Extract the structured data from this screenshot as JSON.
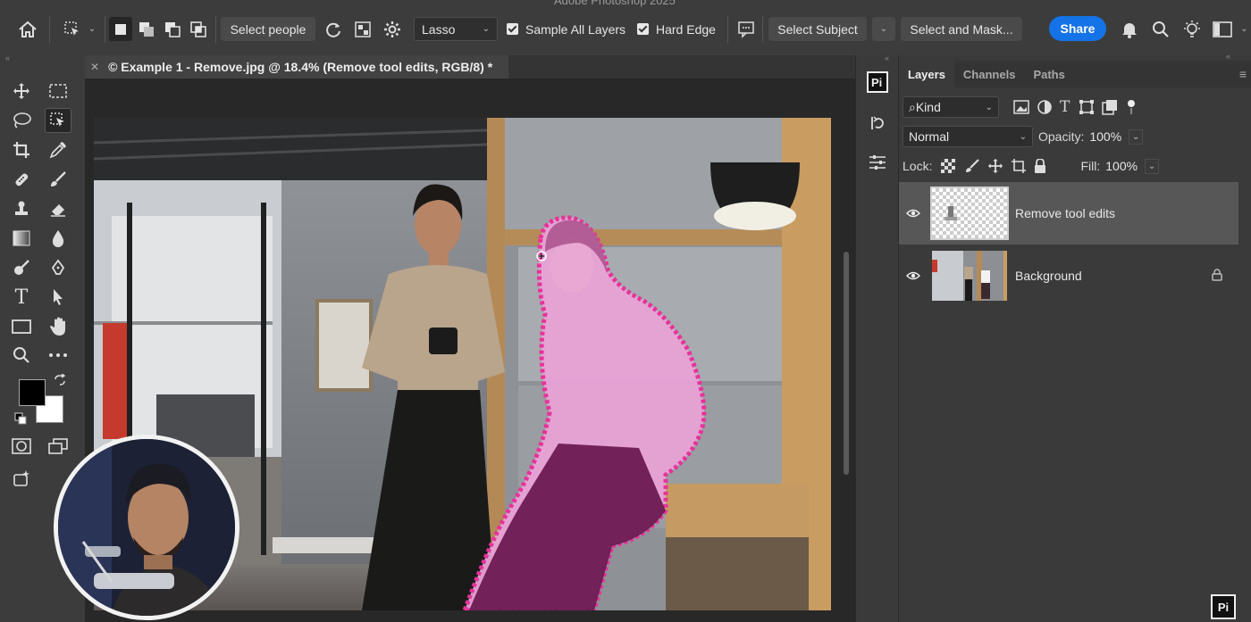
{
  "app": {
    "window_title": "Adobe Photoshop 2025"
  },
  "options_bar": {
    "select_people_label": "Select people",
    "lasso_value": "Lasso",
    "sample_all_layers_label": "Sample All Layers",
    "sample_all_layers_checked": true,
    "hard_edge_label": "Hard Edge",
    "hard_edge_checked": true,
    "select_subject_label": "Select Subject",
    "select_and_mask_label": "Select and Mask...",
    "share_label": "Share",
    "share_color": "#1473e6"
  },
  "document": {
    "tab_title": "© Example 1 - Remove.jpg @ 18.4% (Remove tool edits, RGB/8) *",
    "selection_overlay_color": "#e8329a"
  },
  "layers_panel": {
    "tabs": [
      "Layers",
      "Channels",
      "Paths"
    ],
    "active_tab": "Layers",
    "filter_kind": "Kind",
    "blend_mode": "Normal",
    "opacity_label": "Opacity:",
    "opacity_value": "100%",
    "lock_label": "Lock:",
    "fill_label": "Fill:",
    "fill_value": "100%",
    "layers": [
      {
        "name": "Remove tool edits",
        "selected": true,
        "visible": true,
        "locked": false
      },
      {
        "name": "Background",
        "selected": false,
        "visible": true,
        "locked": true
      }
    ]
  },
  "colors": {
    "foreground": "#000000",
    "background": "#ffffff"
  }
}
